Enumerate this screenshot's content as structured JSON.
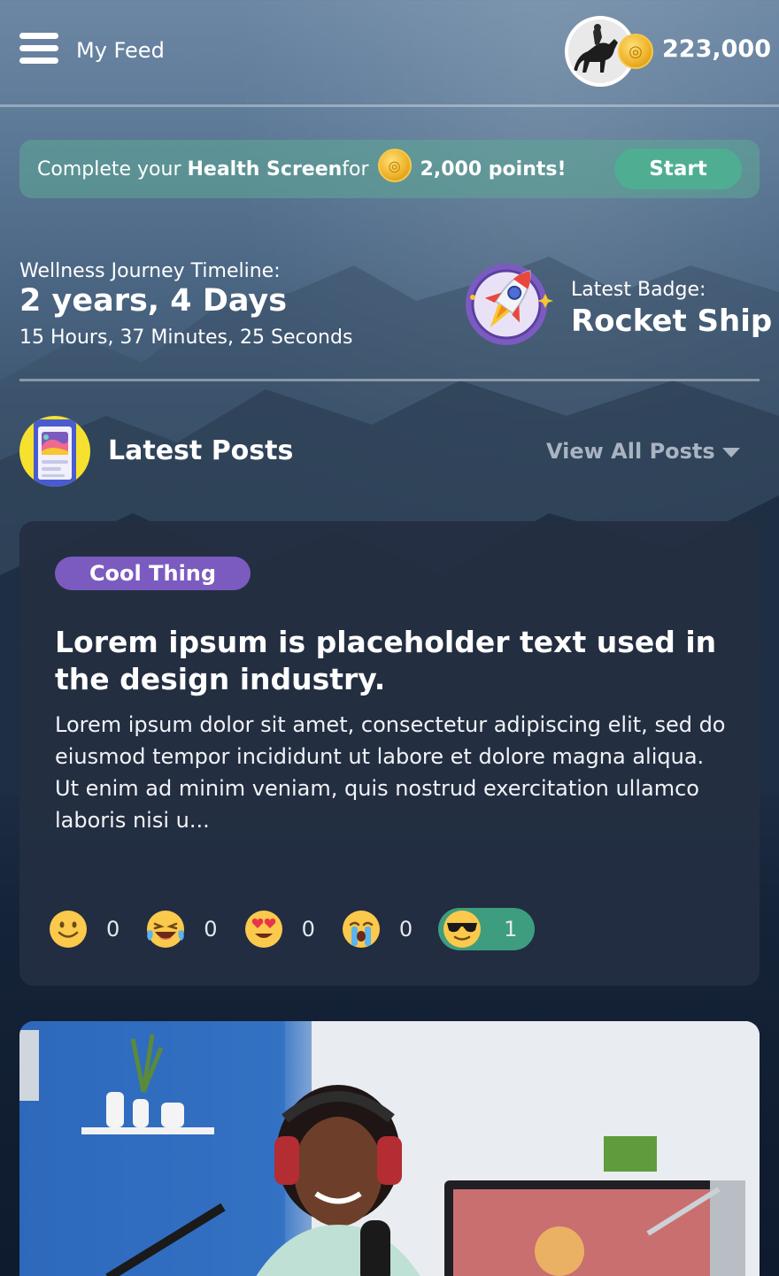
{
  "header": {
    "title": "My Feed",
    "points_total": "223,000"
  },
  "banner": {
    "prefix": "Complete your ",
    "highlight": "Health Screen",
    "middle": " for",
    "points": "2,000 points!",
    "cta": "Start"
  },
  "timeline": {
    "label": "Wellness Journey Timeline:",
    "main": "2 years, 4 Days",
    "sub": "15 Hours, 37 Minutes, 25 Seconds"
  },
  "badge": {
    "label": "Latest Badge:",
    "name": "Rocket Ship"
  },
  "posts_section": {
    "title": "Latest Posts",
    "view_all": "View All Posts"
  },
  "post": {
    "tag": "Cool Thing",
    "title": "Lorem ipsum is placeholder text used in the design industry.",
    "body": "Lorem ipsum dolor sit amet, consectetur adipiscing elit, sed do eiusmod tempor incididunt ut labore et dolore magna aliqua. Ut enim ad minim veniam, quis nostrud exercitation ullamco laboris nisi u...",
    "reactions": [
      {
        "icon": "smile-emoji-icon",
        "count": "0"
      },
      {
        "icon": "laughing-emoji-icon",
        "count": "0"
      },
      {
        "icon": "heart-eyes-emoji-icon",
        "count": "0"
      },
      {
        "icon": "crying-emoji-icon",
        "count": "0"
      },
      {
        "icon": "sunglasses-emoji-icon",
        "count": "1"
      }
    ]
  },
  "colors": {
    "accent_green": "#4fae92",
    "tag_purple": "#7b5bbf",
    "card_bg": "#232e42"
  }
}
